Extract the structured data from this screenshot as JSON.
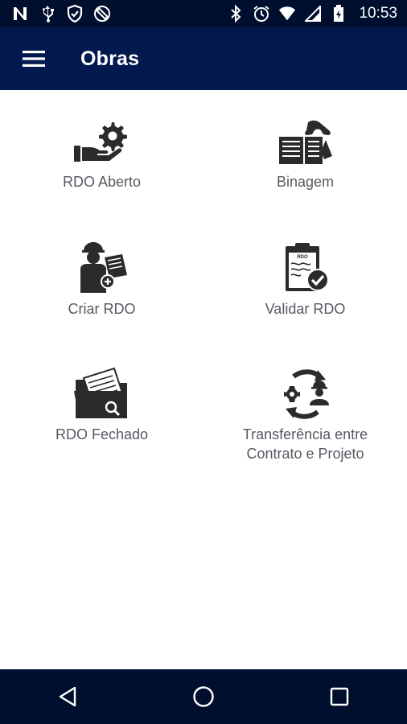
{
  "status_bar": {
    "time": "10:53",
    "left_icons": [
      "n-icon",
      "usb-icon",
      "shield-icon",
      "rotation-lock-icon"
    ],
    "right_icons": [
      "bluetooth-icon",
      "alarm-icon",
      "wifi-icon",
      "signal-icon",
      "battery-icon"
    ]
  },
  "app_bar": {
    "title": "Obras",
    "menu_icon": "hamburger-menu-icon"
  },
  "menu": [
    {
      "label": "RDO Aberto",
      "icon": "hand-gear-icon"
    },
    {
      "label": "Binagem",
      "icon": "book-phone-icon"
    },
    {
      "label": "Criar RDO",
      "icon": "worker-clipboard-icon"
    },
    {
      "label": "Validar RDO",
      "icon": "clipboard-check-icon"
    },
    {
      "label": "RDO Fechado",
      "icon": "folder-search-icon"
    },
    {
      "label": "Transferência entre\nContrato e Projeto",
      "icon": "transfer-cycle-icon"
    }
  ],
  "nav_bar": {
    "icons": [
      "back-icon",
      "home-icon",
      "recents-icon"
    ]
  },
  "colors": {
    "status_bar": "#000f2e",
    "app_bar": "#02194f",
    "nav_bar": "#000f2e",
    "icon": "#2b2b2b",
    "label": "#555a61"
  }
}
